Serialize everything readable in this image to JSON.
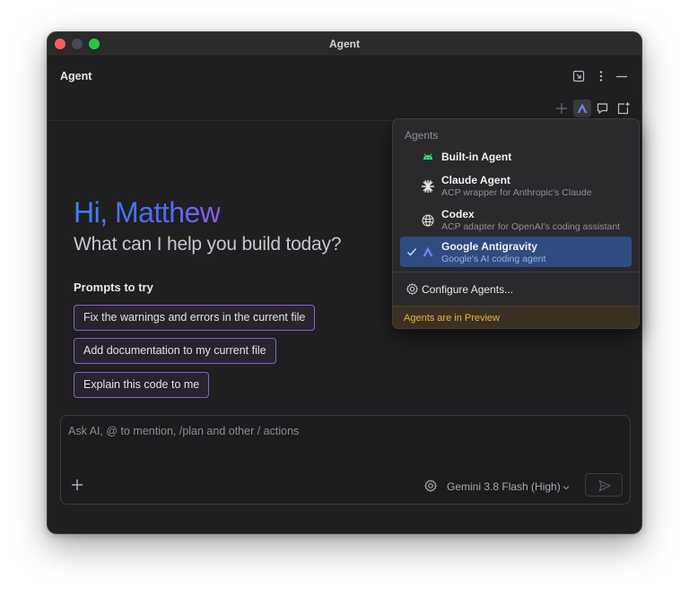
{
  "window": {
    "title": "Agent"
  },
  "panel": {
    "title": "Agent"
  },
  "header_icons": [
    "expand-icon",
    "more-vertical-icon",
    "minimize-icon"
  ],
  "toolbar_icons": [
    "add-icon",
    "antigravity-agent-icon",
    "chat-history-icon",
    "new-chat-icon"
  ],
  "greeting": {
    "hi": "Hi, Matthew",
    "sub": "What can I help you build today?"
  },
  "prompts": {
    "heading": "Prompts to try",
    "items": [
      {
        "label": "Fix the warnings and errors in the current file"
      },
      {
        "label": "Add documentation to my current file"
      },
      {
        "label": "Explain this code to me"
      }
    ]
  },
  "input": {
    "placeholder": "Ask AI, @ to mention, /plan and other / actions",
    "model": "Gemini 3.8 Flash (High)"
  },
  "agents_menu": {
    "heading": "Agents",
    "items": [
      {
        "name": "Built-in Agent",
        "description": "",
        "icon": "android-icon",
        "selected": false
      },
      {
        "name": "Claude Agent",
        "description": "ACP wrapper for Anthropic's Claude",
        "icon": "claude-icon",
        "selected": false
      },
      {
        "name": "Codex",
        "description": "ACP adapter for OpenAI's coding assistant",
        "icon": "openai-icon",
        "selected": false
      },
      {
        "name": "Google Antigravity",
        "description": "Google's AI coding agent",
        "icon": "antigravity-icon",
        "selected": true
      }
    ],
    "configure": "Configure Agents...",
    "footer": "Agents are in Preview"
  },
  "colors": {
    "window_bg": "#1f1f21",
    "greeting_blue": "#3f82f6",
    "greeting_purple": "#8e5bea",
    "chip_border": "#8a5fc6",
    "selected_bg": "#2f4c80",
    "preview_text": "#e3b341"
  }
}
